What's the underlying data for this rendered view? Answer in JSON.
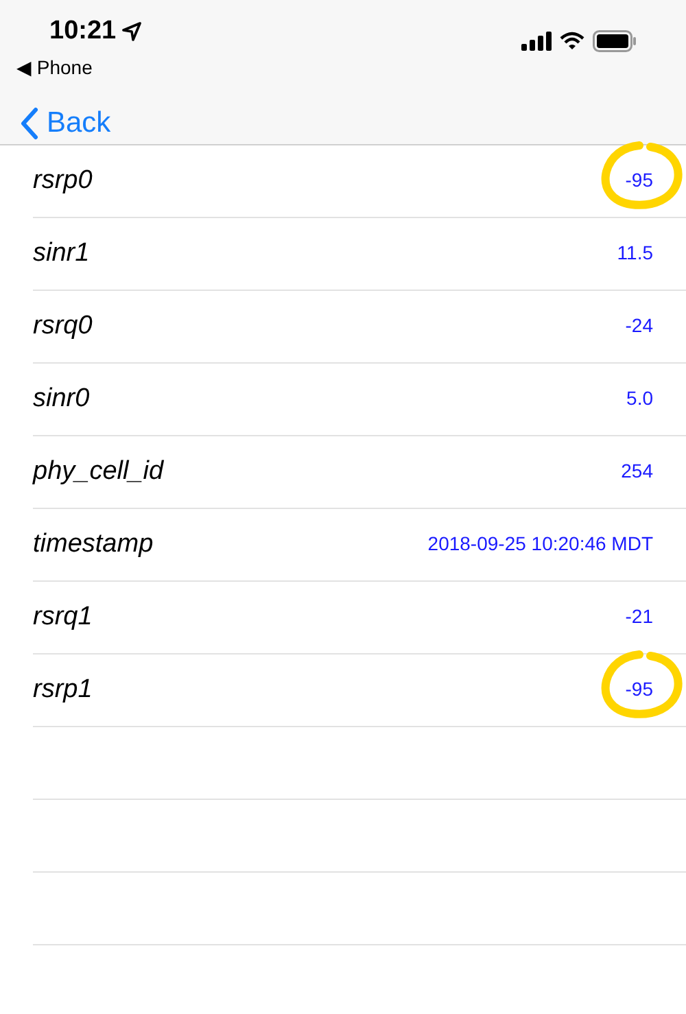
{
  "status_bar": {
    "time": "10:21",
    "back_app": "◀ Phone"
  },
  "nav": {
    "back": "Back"
  },
  "rows": [
    {
      "label": "rsrp0",
      "value": "-95",
      "circled": true
    },
    {
      "label": "sinr1",
      "value": "11.5",
      "circled": false
    },
    {
      "label": "rsrq0",
      "value": "-24",
      "circled": false
    },
    {
      "label": "sinr0",
      "value": "5.0",
      "circled": false
    },
    {
      "label": "phy_cell_id",
      "value": "254",
      "circled": false
    },
    {
      "label": "timestamp",
      "value": "2018-09-25 10:20:46 MDT",
      "circled": false
    },
    {
      "label": "rsrq1",
      "value": "-21",
      "circled": false
    },
    {
      "label": "rsrp1",
      "value": "-95",
      "circled": true
    }
  ]
}
